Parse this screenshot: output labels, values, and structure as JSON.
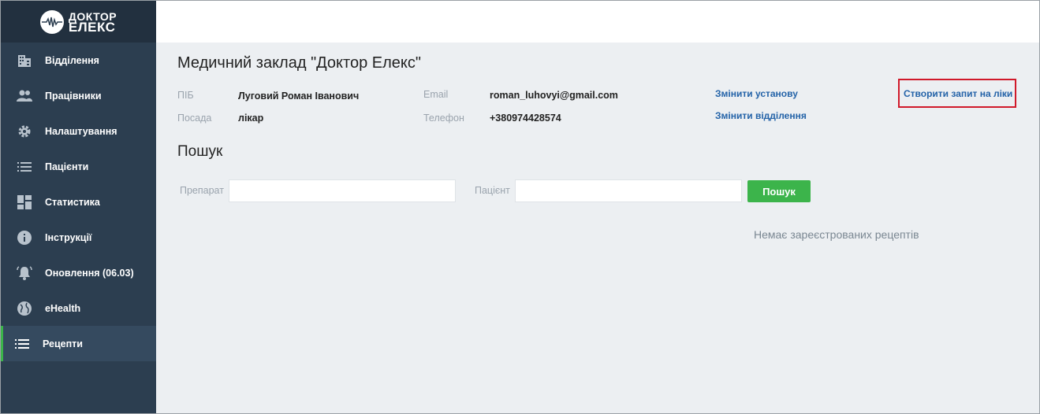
{
  "brand": {
    "line1": "ДОКТОР",
    "line2": "ЕЛЕКС"
  },
  "sidebar": {
    "items": [
      {
        "label": "Відділення",
        "icon": "building-icon"
      },
      {
        "label": "Працівники",
        "icon": "people-icon"
      },
      {
        "label": "Налаштування",
        "icon": "gear-icon"
      },
      {
        "label": "Пацієнти",
        "icon": "list-icon"
      },
      {
        "label": "Статистика",
        "icon": "dashboard-icon"
      },
      {
        "label": "Інструкції",
        "icon": "info-icon"
      },
      {
        "label": "Оновлення (06.03)",
        "icon": "bell-icon"
      },
      {
        "label": "eHealth",
        "icon": "globe-icon"
      },
      {
        "label": "Рецепти",
        "icon": "list-icon",
        "active": true
      }
    ]
  },
  "clinic": {
    "title": "Медичний заклад \"Доктор Елекс\"",
    "name_label": "ПІБ",
    "name_value": "Луговий Роман Іванович",
    "position_label": "Посада",
    "position_value": "лікар",
    "email_label": "Email",
    "email_value": "roman_luhovyi@gmail.com",
    "phone_label": "Телефон",
    "phone_value": "+380974428574",
    "change_facility": "Змінити установу",
    "change_department": "Змінити відділення",
    "create_request": "Створити запит на ліки"
  },
  "search": {
    "title": "Пошук",
    "drug_label": "Препарат",
    "drug_value": "",
    "patient_label": "Пацієнт",
    "patient_value": "",
    "button": "Пошук"
  },
  "empty_message": "Немає зареєстрованих рецептів",
  "colors": {
    "sidebar": "#2c3e50",
    "accent": "#3cb44b",
    "link": "#2463a8",
    "highlight": "#d0192a"
  }
}
